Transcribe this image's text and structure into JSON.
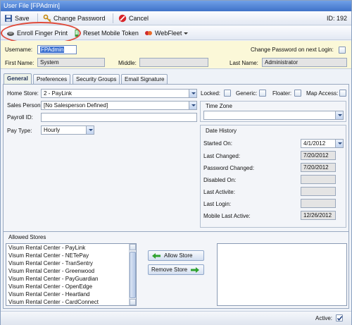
{
  "window": {
    "title": "User File [FPAdmin]"
  },
  "toolbar": {
    "save_label": "Save",
    "change_password_label": "Change Password",
    "cancel_label": "Cancel",
    "id_label": "ID: 192",
    "enroll_label": "Enroll Finger Print",
    "reset_token_label": "Reset Mobile Token",
    "webfleet_label": "WebFleet"
  },
  "user": {
    "username_label": "Username:",
    "username_value": "FPAdmin",
    "change_pw_next_login_label": "Change Password on next Login:",
    "first_name_label": "First Name:",
    "first_name_value": "System",
    "middle_label": "Middle:",
    "middle_value": "",
    "last_name_label": "Last Name:",
    "last_name_value": "Administrator"
  },
  "tabs": [
    "General",
    "Preferences",
    "Security Groups",
    "Email Signature"
  ],
  "general": {
    "home_store_label": "Home Store:",
    "home_store_value": "2 - PayLink",
    "sales_person_label": "Sales Person:",
    "sales_person_value": "[No Salesperson Defined]",
    "payroll_id_label": "Payroll ID:",
    "payroll_id_value": "",
    "pay_type_label": "Pay Type:",
    "pay_type_value": "Hourly",
    "locked_label": "Locked:",
    "generic_label": "Generic:",
    "floater_label": "Floater:",
    "map_access_label": "Map Access:",
    "time_zone_label": "Time Zone",
    "time_zone_value": "",
    "date_history_label": "Date History",
    "started_on_label": "Started On:",
    "started_on_value": "4/1/2012",
    "last_changed_label": "Last Changed:",
    "last_changed_value": "7/20/2012",
    "password_changed_label": "Password Changed:",
    "password_changed_value": "7/20/2012",
    "disabled_on_label": "Disabled On:",
    "disabled_on_value": "",
    "last_activity_label": "Last Activite:",
    "last_activity_value": "",
    "last_login_label": "Last Login:",
    "last_login_value": "",
    "mobile_last_active_label": "Mobile Last Active:",
    "mobile_last_active_value": "12/26/2012"
  },
  "stores": {
    "title": "Allowed Stores",
    "items": [
      "Visum Rental Center - PayLink",
      "Visum Rental Center - NETePay",
      "Visum Rental Center - TranSentry",
      "Visum Rental Center - Greenwood",
      "Visum Rental Center - PayGuardian",
      "Visum Rental Center - OpenEdge",
      "Visum Rental Center - Heartland",
      "Visum Rental Center - CardConnect"
    ],
    "allow_label": "Allow Store",
    "remove_label": "Remove Store"
  },
  "status": {
    "active_label": "Active:"
  },
  "colors": {
    "accent": "#3f72c8",
    "info_band": "#fbf8d8",
    "callout": "#e04a3a",
    "username_highlight": "#3a6fd0"
  }
}
